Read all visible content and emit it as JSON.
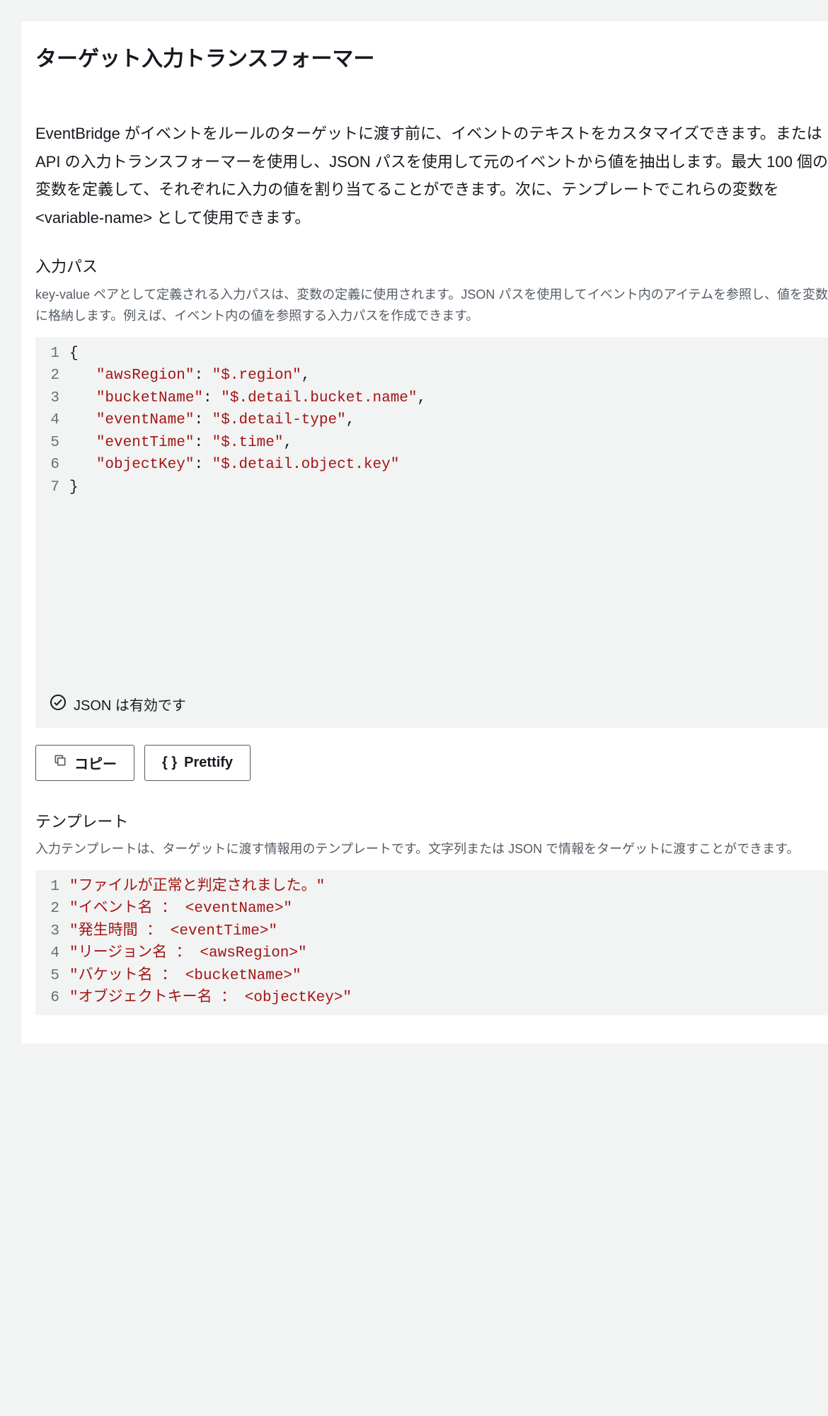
{
  "header": {
    "title": "ターゲット入力トランスフォーマー"
  },
  "description": "EventBridge がイベントをルールのターゲットに渡す前に、イベントのテキストをカスタマイズできます。または API の入力トランスフォーマーを使用し、JSON パスを使用して元のイベントから値を抽出します。最大 100 個の変数を定義して、それぞれに入力の値を割り当てることができます。次に、テンプレートでこれらの変数を <variable-name> として使用できます。",
  "input_path": {
    "title": "入力パス",
    "subtext": "key-value ペアとして定義される入力パスは、変数の定義に使用されます。JSON パスを使用してイベント内のアイテムを参照し、値を変数に格納します。例えば、イベント内の値を参照する入力パスを作成できます。",
    "code": {
      "lines": [
        {
          "num": "1",
          "indent": "",
          "tokens": [
            {
              "t": "punct",
              "v": "{"
            }
          ]
        },
        {
          "num": "2",
          "indent": "   ",
          "tokens": [
            {
              "t": "key",
              "v": "\"awsRegion\""
            },
            {
              "t": "punct",
              "v": ": "
            },
            {
              "t": "str",
              "v": "\"$.region\""
            },
            {
              "t": "punct",
              "v": ","
            }
          ]
        },
        {
          "num": "3",
          "indent": "   ",
          "tokens": [
            {
              "t": "key",
              "v": "\"bucketName\""
            },
            {
              "t": "punct",
              "v": ": "
            },
            {
              "t": "str",
              "v": "\"$.detail.bucket.name\""
            },
            {
              "t": "punct",
              "v": ","
            }
          ]
        },
        {
          "num": "4",
          "indent": "   ",
          "tokens": [
            {
              "t": "key",
              "v": "\"eventName\""
            },
            {
              "t": "punct",
              "v": ": "
            },
            {
              "t": "str",
              "v": "\"$.detail-type\""
            },
            {
              "t": "punct",
              "v": ","
            }
          ]
        },
        {
          "num": "5",
          "indent": "   ",
          "tokens": [
            {
              "t": "key",
              "v": "\"eventTime\""
            },
            {
              "t": "punct",
              "v": ": "
            },
            {
              "t": "str",
              "v": "\"$.time\""
            },
            {
              "t": "punct",
              "v": ","
            }
          ]
        },
        {
          "num": "6",
          "indent": "   ",
          "tokens": [
            {
              "t": "key",
              "v": "\"objectKey\""
            },
            {
              "t": "punct",
              "v": ": "
            },
            {
              "t": "str",
              "v": "\"$.detail.object.key\""
            }
          ]
        },
        {
          "num": "7",
          "indent": "",
          "tokens": [
            {
              "t": "punct",
              "v": "}"
            }
          ]
        }
      ]
    },
    "status": "JSON は有効です"
  },
  "buttons": {
    "copy": "コピー",
    "prettify": "Prettify"
  },
  "template": {
    "title": "テンプレート",
    "subtext": "入力テンプレートは、ターゲットに渡す情報用のテンプレートです。文字列または JSON で情報をターゲットに渡すことができます。",
    "code": {
      "lines": [
        {
          "num": "1",
          "indent": "",
          "tokens": [
            {
              "t": "str",
              "v": "\"ファイルが正常と判定されました。\""
            }
          ]
        },
        {
          "num": "2",
          "indent": "",
          "tokens": [
            {
              "t": "str",
              "v": "\"イベント名 ： <eventName>\""
            }
          ]
        },
        {
          "num": "3",
          "indent": "",
          "tokens": [
            {
              "t": "str",
              "v": "\"発生時間 ： <eventTime>\""
            }
          ]
        },
        {
          "num": "4",
          "indent": "",
          "tokens": [
            {
              "t": "str",
              "v": "\"リージョン名 ： <awsRegion>\""
            }
          ]
        },
        {
          "num": "5",
          "indent": "",
          "tokens": [
            {
              "t": "str",
              "v": "\"バケット名 ： <bucketName>\""
            }
          ]
        },
        {
          "num": "6",
          "indent": "",
          "tokens": [
            {
              "t": "str",
              "v": "\"オブジェクトキー名 ： <objectKey>\""
            }
          ]
        }
      ]
    }
  }
}
